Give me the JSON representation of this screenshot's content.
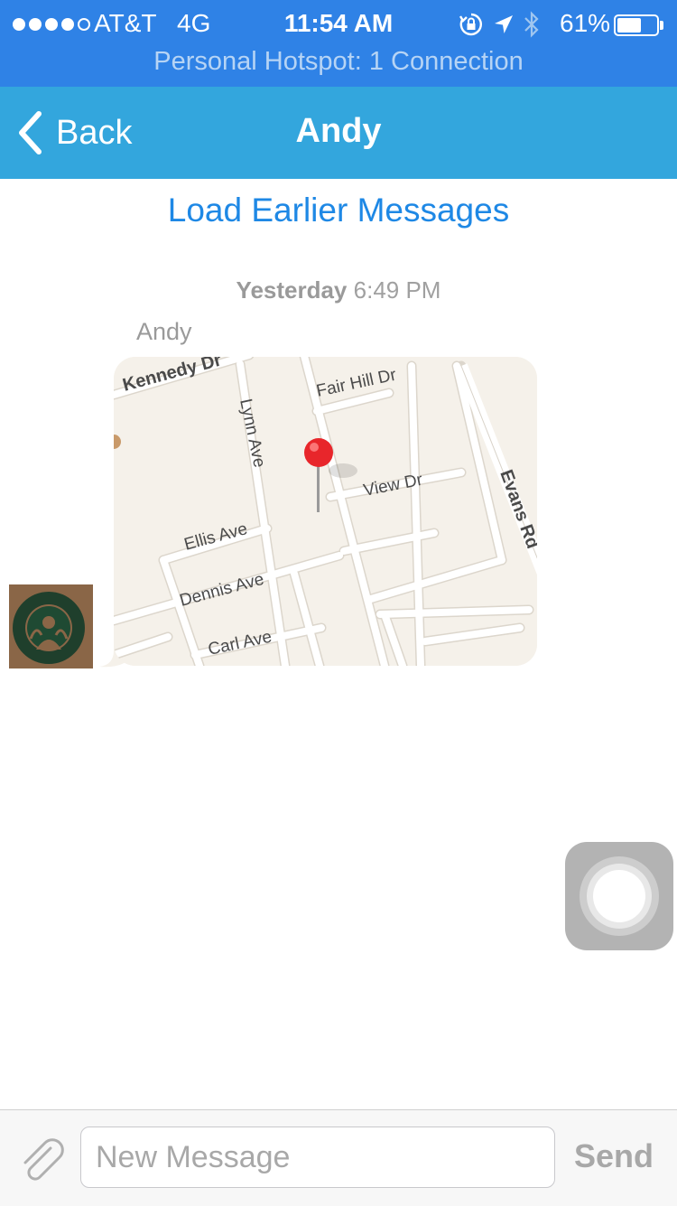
{
  "status_bar": {
    "carrier": "AT&T",
    "network": "4G",
    "time": "11:54 AM",
    "battery_percent": "61%",
    "battery_level": 0.61,
    "hotspot_text": "Personal Hotspot: 1 Connection",
    "icons": [
      "signal-dots",
      "rotation-lock-icon",
      "location-arrow-icon",
      "bluetooth-icon",
      "battery-icon"
    ]
  },
  "nav": {
    "back_label": "Back",
    "title": "Andy"
  },
  "conversation": {
    "load_earlier": "Load Earlier Messages",
    "timestamp_day": "Yesterday",
    "timestamp_time": "6:49 PM",
    "messages": [
      {
        "sender": "Andy",
        "type": "location-map",
        "map_labels": {
          "kennedy": "Kennedy Dr",
          "fair_hill": "Fair Hill Dr",
          "lynn": "Lynn Ave",
          "view": "View Dr",
          "evans": "Evans Rd",
          "ellis": "Ellis Ave",
          "dennis": "Dennis Ave",
          "carl": "Carl Ave"
        }
      }
    ]
  },
  "composer": {
    "placeholder": "New Message",
    "value": "",
    "send_label": "Send"
  },
  "colors": {
    "status_bar_bg": "#2f82e6",
    "nav_bar_bg": "#33a6dd",
    "link_blue": "#1e88e5",
    "pin_red": "#e8262b"
  }
}
